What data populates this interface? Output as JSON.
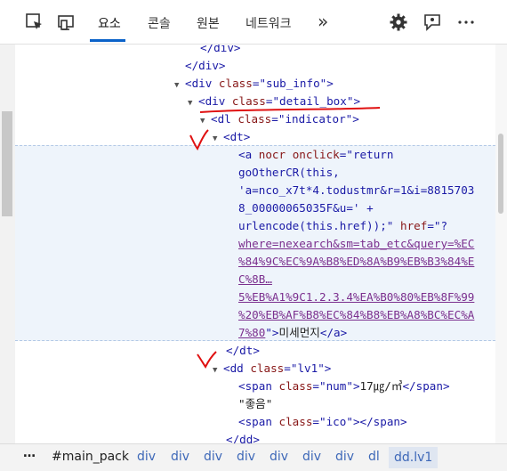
{
  "toolbar": {
    "tabs": [
      "요소",
      "콘솔",
      "원본",
      "네트워크"
    ],
    "more_tabs": "»",
    "icons": [
      "inspect-element-icon",
      "device-emulation-icon",
      "settings-gear-icon",
      "feedback-icon",
      "more-options-icon"
    ]
  },
  "code": {
    "l1": "</div>",
    "l2": "</div>",
    "l3_tag": "<div ",
    "l3_attr": "class",
    "l3_val": "\"sub_info\"",
    "l3_end": ">",
    "l4_tag": "<div ",
    "l4_attr": "class",
    "l4_val": "\"detail_box\"",
    "l4_end": ">",
    "l5_tag": "<dl ",
    "l5_attr": "class",
    "l5_val": "\"indicator\"",
    "l5_end": ">",
    "l6": "<dt>",
    "a_l1_tag": "<a ",
    "a_l1_attr1": "nocr",
    "a_l1_attr2": "onclick",
    "a_l1_val": "\"return",
    "a_l2": "goOtherCR(this,",
    "a_l3": "'a=nco_x7t*4.todustmr&r=1&i=8815703",
    "a_l4": "8_00000065035F&u='",
    "a_l4b": " +",
    "a_l5": "urlencode(this.href));\"",
    "a_l5_attr": "href",
    "a_l5_val": "\"?",
    "a_l6": "where=nexearch&sm=tab_etc&query=%EC",
    "a_l7": "%84%9C%EC%9A%B8%ED%8A%B9%EB%B3%84%E",
    "a_l8": "C%8B…",
    "a_l9": "5%EB%A1%9C1.2.3.4%EA%B0%80%EB%8F%99",
    "a_l10": "%20%EB%AF%B8%EC%84%B8%EB%A8%BC%EC%A",
    "a_l11_link": "7%80",
    "a_l11_q": "\">",
    "a_l11_text": "미세먼지",
    "a_l11_end": "</a>",
    "dt_close": "</dt>",
    "dd_tag": "<dd ",
    "dd_attr": "class",
    "dd_val": "\"lv1\"",
    "dd_end": ">",
    "span1_tag": "<span ",
    "span1_attr": "class",
    "span1_val": "\"num\"",
    "span1_end": ">",
    "span1_text": "17㎍/㎥",
    "span1_close": "</span>",
    "good_text": "\"좋음\"",
    "span2_tag": "<span ",
    "span2_attr": "class",
    "span2_val": "\"ico\"",
    "span2_end": "></span>",
    "dd_close": "</dd>"
  },
  "breadcrumbs": {
    "more": "…",
    "items": [
      "#main_pack",
      "div",
      "div",
      "div",
      "div",
      "div",
      "div",
      "div",
      "dl",
      "dd.lv1"
    ]
  },
  "colors": {
    "tag": "#1a1aa6",
    "attr": "#871616",
    "annotation": "#e01010",
    "selected_tab": "#0a62c9"
  }
}
